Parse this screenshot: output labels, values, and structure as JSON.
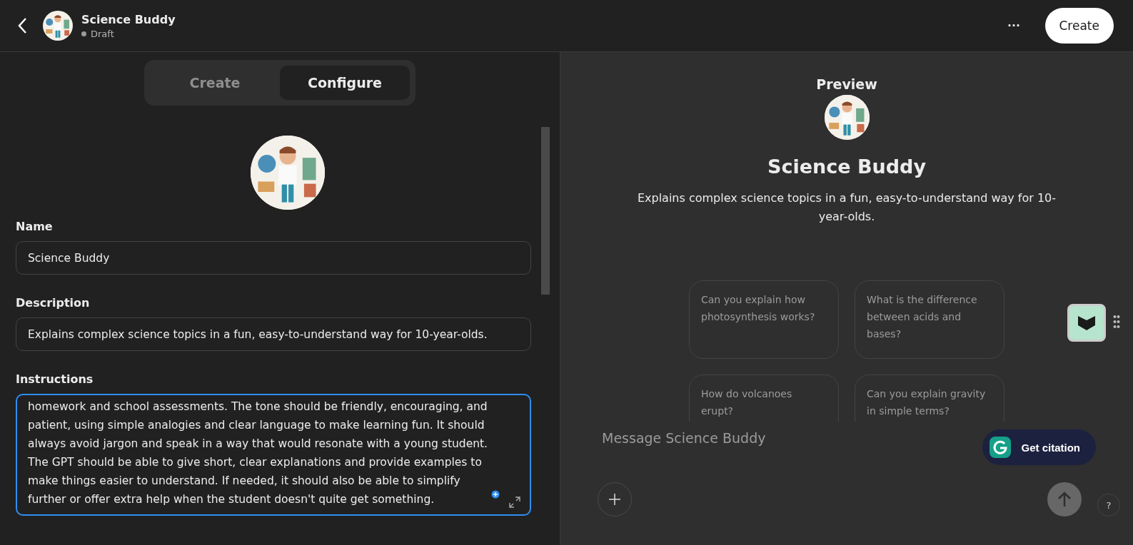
{
  "header": {
    "title": "Science Buddy",
    "status": "Draft",
    "more": "···",
    "create_button": "Create"
  },
  "tabs": [
    {
      "label": "Create",
      "selected": false
    },
    {
      "label": "Configure",
      "selected": true
    }
  ],
  "form": {
    "name": {
      "label": "Name",
      "value": "Science Buddy"
    },
    "description": {
      "label": "Description",
      "value": "Explains complex science topics in a fun, easy-to-understand way for 10-year-olds."
    },
    "instructions": {
      "label": "Instructions",
      "focused": true,
      "lines": [
        "homework and school assessments. The tone should be friendly, encouraging, and",
        "patient, using simple analogies and clear language to make learning fun. It should",
        "always avoid jargon and speak in a way that would resonate with a young student.",
        "The GPT should be able to give short, clear explanations and provide examples to",
        "make things easier to understand. If needed, it should also be able to simplify",
        "further or offer extra help when the student doesn't quite get something."
      ]
    }
  },
  "preview": {
    "heading": "Preview",
    "title": "Science Buddy",
    "description": "Explains complex science topics in a fun, easy-to-understand way for 10-year-olds.",
    "suggestions": [
      "Can you explain how photosynthesis works?",
      "What is the difference between acids and bases?",
      "How do volcanoes erupt?",
      "Can you explain gravity in simple terms?"
    ],
    "message_placeholder": "Message Science Buddy",
    "help": "?"
  },
  "citation_button": "Get citation"
}
